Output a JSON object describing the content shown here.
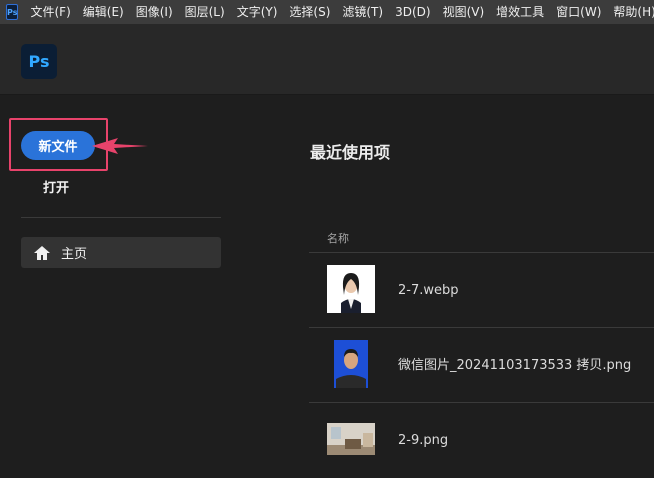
{
  "menubar": {
    "app_icon": "Ps",
    "items": [
      "文件(F)",
      "编辑(E)",
      "图像(I)",
      "图层(L)",
      "文字(Y)",
      "选择(S)",
      "滤镜(T)",
      "3D(D)",
      "视图(V)",
      "增效工具",
      "窗口(W)",
      "帮助(H)"
    ]
  },
  "header": {
    "logo": "Ps"
  },
  "sidebar": {
    "new_file_label": "新文件",
    "open_label": "打开",
    "home_label": "主页"
  },
  "main": {
    "section_title": "最近使用项",
    "column_name": "名称",
    "files": [
      {
        "name": "2-7.webp",
        "thumb": "portrait-white-bg-icon"
      },
      {
        "name": "微信图片_20241103173533 拷贝.png",
        "thumb": "portrait-blue-bg-icon"
      },
      {
        "name": "2-9.png",
        "thumb": "room-photo-icon"
      }
    ]
  },
  "colors": {
    "accent": "#2a73d9",
    "highlight": "#e8436b",
    "background": "#1e1e1e"
  }
}
